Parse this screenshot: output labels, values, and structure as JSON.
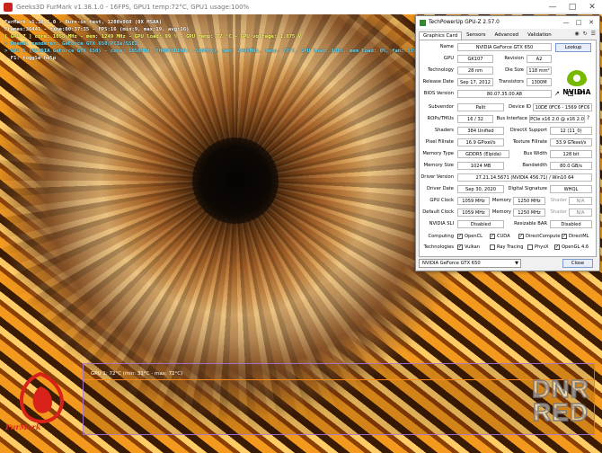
{
  "furmark": {
    "window_title": "Geeks3D FurMark v1.38.1.0 - 16FPS, GPU1 temp:72°C, GPU1 usage:100%",
    "overlay": [
      "FurMark v1.38.1.0 - Burn-in test, 1280x960 (0X MSAA)",
      "Frames:36441 - time:00:37:35 - FPS:16 (min:9, max:19, avg:16)",
      "[ GPU-Z ] core: 1058 MHz - mem: 1249 MHz - GPU load: 99 % - GPU temp: 72 °C - GPU voltage: 1.075 V",
      "> OpenGL renderer: GeForce GTX 650/PCIe/SSE2",
      "> GPU 1 (NVIDIA GeForce GTX 650) - core: 1058MHz (THROTTLING: -506MHz), mem: 2499MHz, temp: 72°C, GPU load: 100%, mem load: 0%, fan: 33%",
      "- F1: toggle help"
    ],
    "graph_label": "GPU 1: 72°C (min: 31°C - max: 72°C)",
    "logo_text": "FurMark",
    "watermark": [
      "DNR",
      "RED"
    ]
  },
  "gpuz": {
    "title": "TechPowerUp GPU-Z 2.57.0",
    "tabs": [
      "Graphics Card",
      "Sensors",
      "Advanced",
      "Validation"
    ],
    "name": "NVIDIA GeForce GTX 650",
    "lookup": "Lookup",
    "gpu": "GK107",
    "revision": "A2",
    "technology": "28 nm",
    "die_size": "118 mm²",
    "release_date": "Sep 17, 2012",
    "transistors": "1300M",
    "bios_version": "80.07.35.00.A8",
    "uefi": "UEFI",
    "subvendor": "Palit",
    "device_id": "10DE 0FC6 - 1569 0FC6",
    "rops_tmus": "16 / 32",
    "bus_interface": "PCIe x16 2.0 @ x16 2.0",
    "shaders": "384 Unified",
    "directx_support": "12 (11_0)",
    "pixel_fillrate": "16.9 GPixel/s",
    "texture_fillrate": "33.9 GTexel/s",
    "memory_type": "GDDR5 (Elpida)",
    "bus_width": "128 bit",
    "memory_size": "1024 MB",
    "bandwidth": "80.0 GB/s",
    "driver_version": "27.21.14.5671 (NVIDIA 456.71) / Win10 64",
    "driver_date": "Sep 30, 2020",
    "digital_signature": "WHQL",
    "gpu_clock": "1059 MHz",
    "memory_clock": "1250 MHz",
    "shader_clock": "N/A",
    "default_clock": "1059 MHz",
    "default_memory": "1250 MHz",
    "default_shader": "N/A",
    "nvidia_sli": "Disabled",
    "resizable_bar": "Disabled",
    "labels": {
      "name": "Name",
      "gpu": "GPU",
      "revision": "Revision",
      "technology": "Technology",
      "die_size": "Die Size",
      "release_date": "Release Date",
      "transistors": "Transistors",
      "bios_version": "BIOS Version",
      "subvendor": "Subvendor",
      "device_id": "Device ID",
      "rops_tmus": "ROPs/TMUs",
      "bus_interface": "Bus Interface",
      "shaders": "Shaders",
      "directx_support": "DirectX Support",
      "pixel_fillrate": "Pixel Fillrate",
      "texture_fillrate": "Texture Fillrate",
      "memory_type": "Memory Type",
      "bus_width": "Bus Width",
      "memory_size": "Memory Size",
      "bandwidth": "Bandwidth",
      "driver_version": "Driver Version",
      "driver_date": "Driver Date",
      "digital_signature": "Digital Signature",
      "gpu_clock": "GPU Clock",
      "memory": "Memory",
      "shader": "Shader",
      "default_clock": "Default Clock",
      "nvidia_sli": "NVIDIA SLI",
      "resizable_bar": "Resizable BAR",
      "computing": "Computing",
      "technologies": "Technologies"
    },
    "computing": [
      "OpenCL",
      "CUDA",
      "DirectCompute",
      "DirectML"
    ],
    "technologies": [
      "Vulkan",
      "Ray Tracing",
      "PhysX",
      "OpenGL 4.6"
    ],
    "tech_checked": [
      true,
      false,
      false,
      true
    ],
    "selected_gpu": "NVIDIA GeForce GTX 650",
    "close": "Close",
    "brand_colors": {
      "nvidia_green": "#76b900"
    }
  }
}
